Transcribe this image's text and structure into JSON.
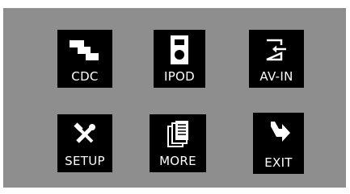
{
  "menu": {
    "items": [
      {
        "id": "cdc",
        "label": "CDC",
        "icon": "cd-changer-icon"
      },
      {
        "id": "ipod",
        "label": "IPOD",
        "icon": "ipod-speaker-icon"
      },
      {
        "id": "av-in",
        "label": "AV-IN",
        "icon": "input-arrow-icon"
      },
      {
        "id": "setup",
        "label": "SETUP",
        "icon": "tools-icon"
      },
      {
        "id": "more",
        "label": "MORE",
        "icon": "pages-icon"
      },
      {
        "id": "exit",
        "label": "EXIT",
        "icon": "exit-arrow-icon"
      }
    ]
  },
  "colors": {
    "background": "#8e8e8e",
    "tile": "#000000",
    "text": "#ffffff"
  }
}
